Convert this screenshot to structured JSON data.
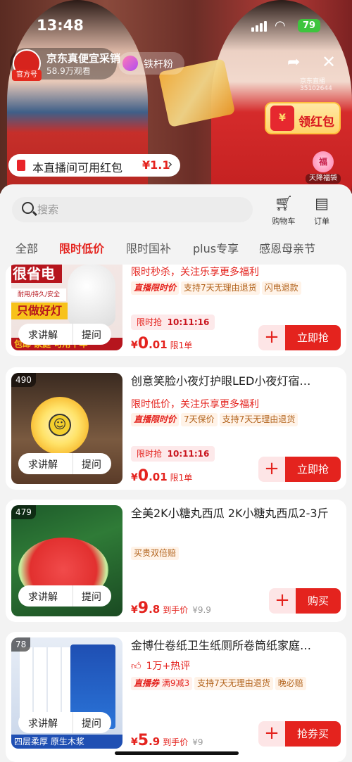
{
  "status_bar": {
    "time": "13:48",
    "battery": "79"
  },
  "live": {
    "host_name": "京东真便宜采销",
    "host_badge": "真便宜",
    "host_tag": "官方号",
    "viewers": "58.9万观看",
    "fans_label": "铁杆粉",
    "room_id": "京东直播 35102644",
    "red_packet_label": "领红包",
    "red_packet_icon": "¥",
    "lucky_bag_icon": "福",
    "lucky_bag_label": "天降福袋",
    "available_text": "本直播间可用红包",
    "available_amount": "¥1.1"
  },
  "panel": {
    "search_placeholder": "搜索",
    "cart_label": "购物车",
    "orders_label": "订单",
    "tabs": [
      "全部",
      "限时低价",
      "限时国补",
      "plus专享",
      "感恩母亲节"
    ],
    "active_tab": 1
  },
  "products": [
    {
      "thumb_text1": "很省电",
      "thumb_text2": "只做好灯",
      "thumb_text3": "耐用/持久/安全",
      "thumb_bottom": "包邮  家庭  可用十年",
      "promo": "限时秒杀，关注乐享更多福利",
      "tags": [
        "直播限时价",
        "支持7天无理由退货",
        "闪电退款"
      ],
      "timer_label": "限时抢",
      "timer": "10:11:16",
      "currency": "¥",
      "price_big": "0",
      "price_small": ".01",
      "price_note": "限1单",
      "button": "立即抢",
      "ask": "求讲解",
      "question": "提问"
    },
    {
      "rank": "490",
      "title": "创意笑脸小夜灯护眼LED小夜灯宿…",
      "promo": "限时低价，关注乐享更多福利",
      "tags": [
        "直播限时价",
        "7天保价",
        "支持7天无理由退货"
      ],
      "timer_label": "限时抢",
      "timer": "10:11:16",
      "currency": "¥",
      "price_big": "0",
      "price_small": ".01",
      "price_note": "限1单",
      "button": "立即抢",
      "ask": "求讲解",
      "question": "提问"
    },
    {
      "rank": "479",
      "title": "全美2K小糖丸西瓜 2K小糖丸西瓜2-3斤",
      "tags": [
        "买贵双倍赔"
      ],
      "currency": "¥",
      "price_big": "9",
      "price_small": ".8",
      "price_note": "到手价",
      "price_orig": "¥9.9",
      "button": "购买",
      "ask": "求讲解",
      "question": "提问"
    },
    {
      "rank": "78",
      "title": "金博仕卷纸卫生纸厕所卷筒纸家庭…",
      "hot": "1万+热评",
      "coupon": "直播券",
      "coupon_detail": "满9减3",
      "tags": [
        "支持7天无理由退货",
        "晚必赔"
      ],
      "thumb_bottom": "四层柔厚 原生木浆",
      "currency": "¥",
      "price_big": "5",
      "price_small": ".9",
      "price_note": "到手价",
      "price_orig": "¥9",
      "button": "抢券买",
      "ask": "求讲解",
      "question": "提问"
    }
  ],
  "colors": {
    "accent": "#e4231e",
    "panel_bg": "#f3f3f3"
  }
}
